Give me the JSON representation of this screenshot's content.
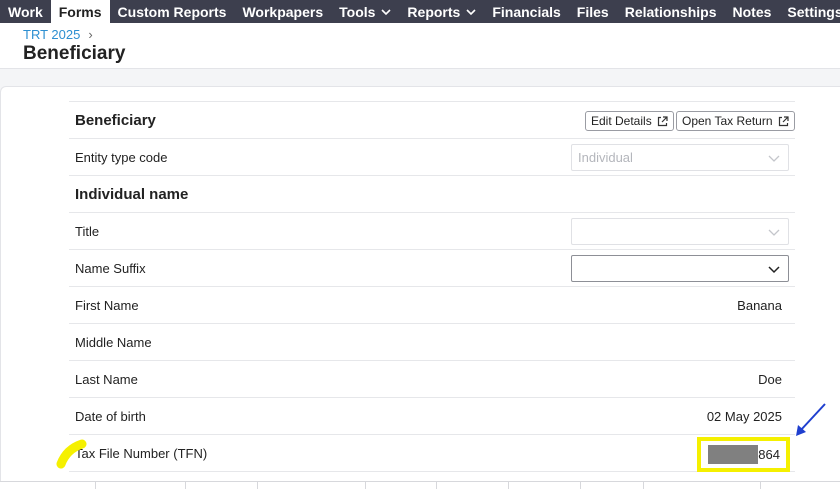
{
  "nav": {
    "items": [
      {
        "label": "Work"
      },
      {
        "label": "Forms",
        "active": true
      },
      {
        "label": "Custom Reports"
      },
      {
        "label": "Workpapers"
      },
      {
        "label": "Tools",
        "dropdown": true
      },
      {
        "label": "Reports",
        "dropdown": true
      },
      {
        "label": "Financials"
      },
      {
        "label": "Files"
      },
      {
        "label": "Relationships"
      },
      {
        "label": "Notes"
      },
      {
        "label": "Settings",
        "dropdown": true
      }
    ]
  },
  "header": {
    "breadcrumb": "TRT 2025",
    "breadcrumb_sep": "›",
    "title": "Beneficiary"
  },
  "form": {
    "section_title": "Beneficiary",
    "edit_details_label": "Edit Details",
    "open_tax_return_label": "Open Tax Return",
    "entity_type_label": "Entity type code",
    "entity_type_value": "Individual",
    "individual_name_title": "Individual name",
    "title_label": "Title",
    "title_value": "",
    "name_suffix_label": "Name Suffix",
    "name_suffix_value": "",
    "first_name_label": "First Name",
    "first_name_value": "Banana",
    "middle_name_label": "Middle Name",
    "middle_name_value": "",
    "last_name_label": "Last Name",
    "last_name_value": "Doe",
    "dob_label": "Date of birth",
    "dob_value": "02 May 2025",
    "tfn_label": "Tax File Number (TFN)",
    "tfn_visible_digits": "864"
  },
  "colors": {
    "nav_bg": "#3d3f4e",
    "link_blue": "#2d8fd1",
    "highlight_yellow": "#f5f000",
    "annotation_arrow": "#1f3fcf"
  }
}
